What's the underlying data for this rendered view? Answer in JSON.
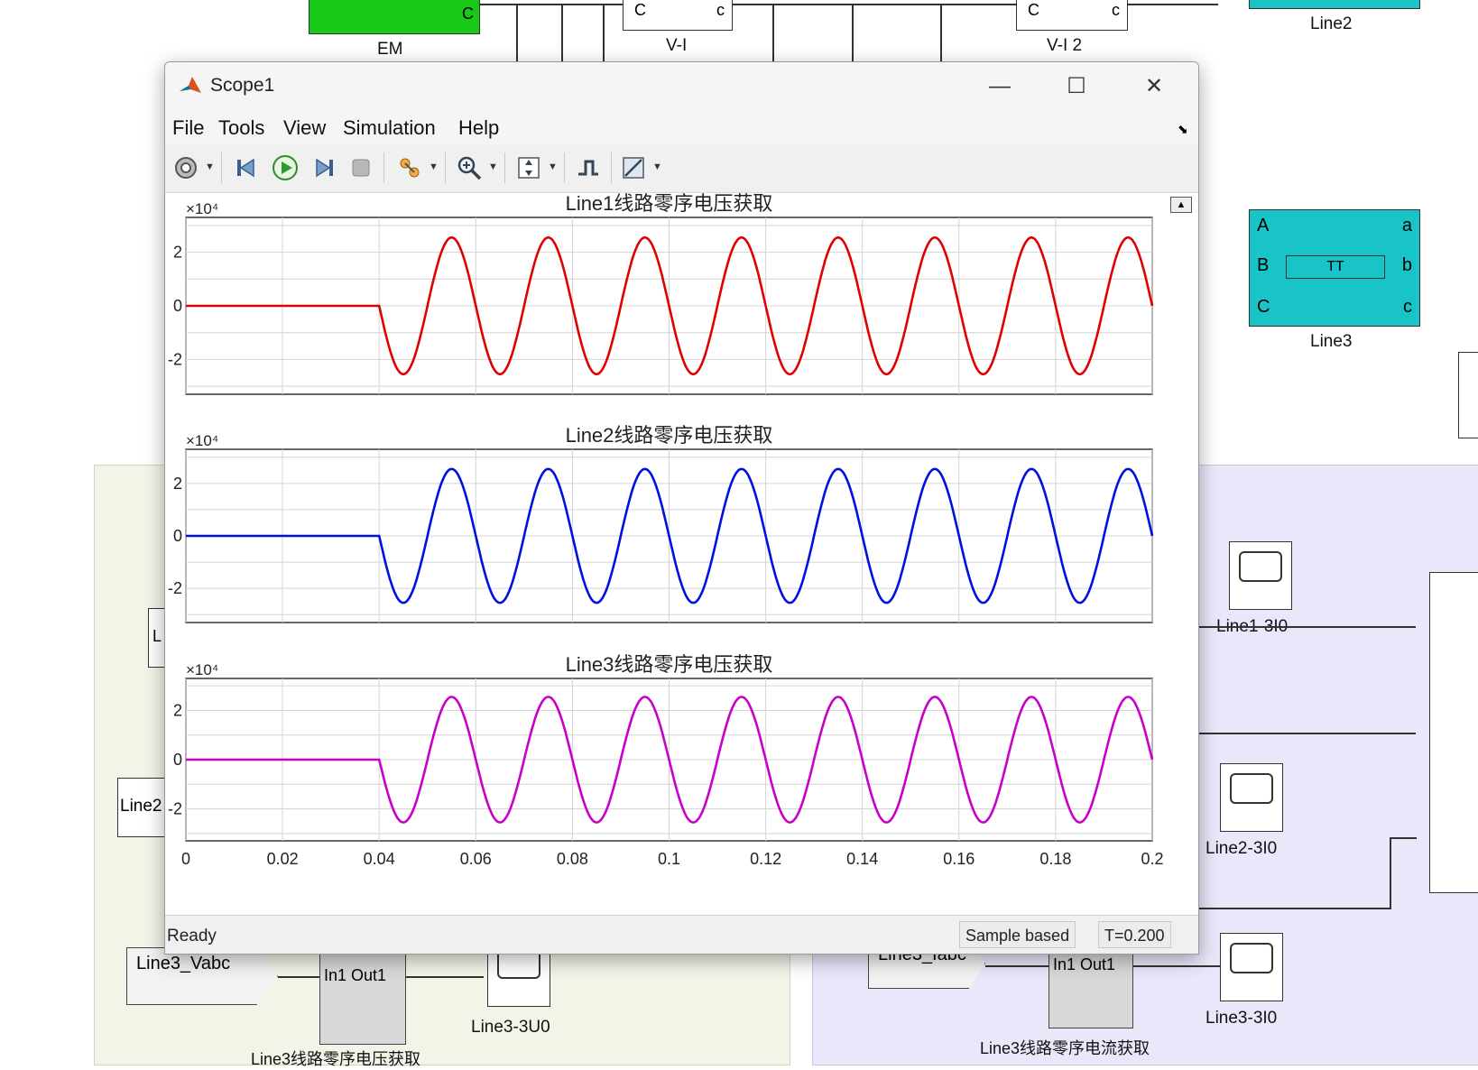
{
  "model": {
    "blocks": {
      "em_label": "EM",
      "vi_label": "V-I",
      "vi_c_left": "C",
      "vi_c_right": "c",
      "vi2_label": "V-I 2",
      "vi2_c_left": "C",
      "vi2_c_right": "c",
      "em_c": "C",
      "line2_label": "Line2",
      "line3_label": "Line3",
      "line3_ports_left": [
        "A",
        "B",
        "C"
      ],
      "line3_ports_right": [
        "a",
        "b",
        "c"
      ],
      "line3_symbol": "TT",
      "line1_3i0": "Line1-3I0",
      "line2_3i0": "Line2-3I0",
      "line3_3i0": "Line3-3I0",
      "line3_vabc_tag": "Line3_Vabc",
      "line3_iabc_tag": "Line3_Iabc",
      "in1_out1": "In1 Out1",
      "in1_out1_b": "In1 Out1",
      "line3_3u0": "Line3-3U0",
      "line3_voltage_sub": "Line3线路零序电压获取",
      "line3_current_sub": "Line3线路零序电流获取",
      "left_partial_a": "L",
      "left_partial_b": "Line2"
    }
  },
  "scope": {
    "title": "Scope1",
    "window_controls": {
      "minimize": "—",
      "maximize": "☐",
      "close": "✕"
    },
    "menu": [
      "File",
      "Tools",
      "View",
      "Simulation",
      "Help"
    ],
    "toolbar_icons": [
      "gear-icon",
      "step-back-icon",
      "run-icon",
      "step-forward-icon",
      "stop-icon",
      "highlight-icon",
      "zoom-icon",
      "autoscale-icon",
      "triggers-icon",
      "measure-icon"
    ],
    "status": {
      "left": "Ready",
      "mode": "Sample based",
      "time": "T=0.200"
    }
  },
  "chart_data": [
    {
      "type": "line",
      "title": "Line1线路零序电压获取",
      "exponent_label": "×10⁴",
      "xlim": [
        0,
        0.2
      ],
      "ylim": [
        -3.3,
        3.3
      ],
      "yticks": [
        2,
        0,
        -2
      ],
      "ytick_labels": [
        "2",
        "0",
        "-2"
      ],
      "grid": true,
      "series": [
        {
          "color": "#e00000",
          "amplitude": 2.55,
          "frequency_hz": 50,
          "onset": 0.04,
          "phase_start": "negative"
        }
      ]
    },
    {
      "type": "line",
      "title": "Line2线路零序电压获取",
      "exponent_label": "×10⁴",
      "xlim": [
        0,
        0.2
      ],
      "ylim": [
        -3.3,
        3.3
      ],
      "yticks": [
        2,
        0,
        -2
      ],
      "ytick_labels": [
        "2",
        "0",
        "-2"
      ],
      "grid": true,
      "series": [
        {
          "color": "#0010e0",
          "amplitude": 2.55,
          "frequency_hz": 50,
          "onset": 0.04,
          "phase_start": "negative"
        }
      ]
    },
    {
      "type": "line",
      "title": "Line3线路零序电压获取",
      "exponent_label": "×10⁴",
      "xlim": [
        0,
        0.2
      ],
      "ylim": [
        -3.3,
        3.3
      ],
      "yticks": [
        2,
        0,
        -2
      ],
      "ytick_labels": [
        "2",
        "0",
        "-2"
      ],
      "xticks": [
        0,
        0.02,
        0.04,
        0.06,
        0.08,
        0.1,
        0.12,
        0.14,
        0.16,
        0.18,
        0.2
      ],
      "xtick_labels": [
        "0",
        "0.02",
        "0.04",
        "0.06",
        "0.08",
        "0.1",
        "0.12",
        "0.14",
        "0.16",
        "0.18",
        "0.2"
      ],
      "grid": true,
      "series": [
        {
          "color": "#c800c8",
          "amplitude": 2.55,
          "frequency_hz": 50,
          "onset": 0.04,
          "phase_start": "negative"
        }
      ]
    }
  ]
}
